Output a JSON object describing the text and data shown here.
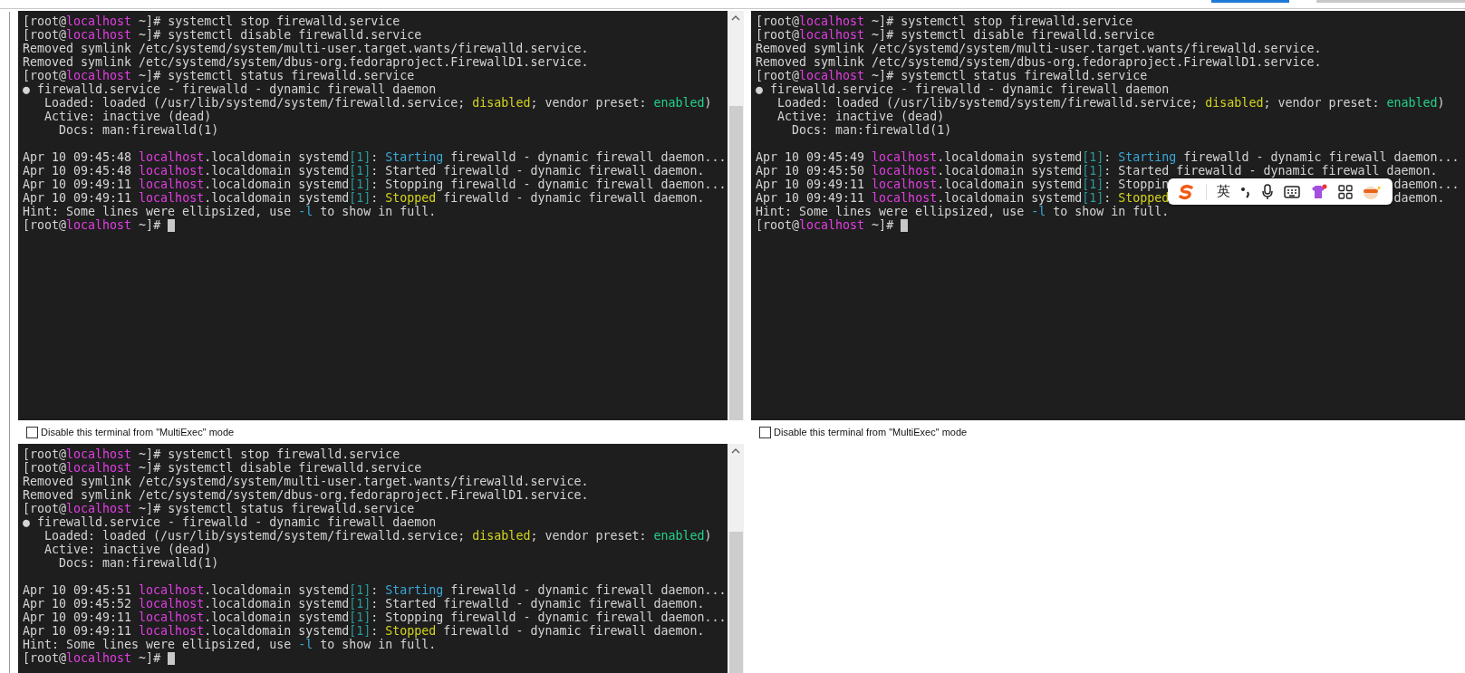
{
  "terminals": [
    {
      "scrollbar": true,
      "lines": [
        {
          "segments": [
            {
              "text": "[root@"
            },
            {
              "text": "localhost",
              "color": "#e23ee2"
            },
            {
              "text": " ~]# systemctl stop firewalld.service"
            }
          ]
        },
        {
          "segments": [
            {
              "text": "[root@"
            },
            {
              "text": "localhost",
              "color": "#e23ee2"
            },
            {
              "text": " ~]# systemctl disable firewalld.service"
            }
          ]
        },
        {
          "segments": [
            {
              "text": "Removed symlink /etc/systemd/system/multi-user.target.wants/firewalld.service."
            }
          ]
        },
        {
          "segments": [
            {
              "text": "Removed symlink /etc/systemd/system/dbus-org.fedoraproject.FirewallD1.service."
            }
          ]
        },
        {
          "segments": [
            {
              "text": "[root@"
            },
            {
              "text": "localhost",
              "color": "#e23ee2"
            },
            {
              "text": " ~]# systemctl status firewalld.service"
            }
          ]
        },
        {
          "segments": [
            {
              "text": "● firewalld.service - firewalld - dynamic firewall daemon"
            }
          ]
        },
        {
          "segments": [
            {
              "text": "   Loaded: loaded (/usr/lib/systemd/system/firewalld.service; "
            },
            {
              "text": "disabled",
              "color": "#d4d41e"
            },
            {
              "text": "; vendor preset: "
            },
            {
              "text": "enabled",
              "color": "#23d18b"
            },
            {
              "text": ")"
            }
          ]
        },
        {
          "segments": [
            {
              "text": "   Active: inactive (dead)"
            }
          ]
        },
        {
          "segments": [
            {
              "text": "     Docs: man:firewalld(1)"
            }
          ]
        },
        {
          "kind": "blank"
        },
        {
          "segments": [
            {
              "text": "Apr 10 09:45:48 "
            },
            {
              "text": "localhost",
              "color": "#e23ee2"
            },
            {
              "text": ".localdomain systemd"
            },
            {
              "text": "[1]",
              "color": "#2a9a9a"
            },
            {
              "text": ": "
            },
            {
              "text": "Starting",
              "color": "#3aa8d8"
            },
            {
              "text": " firewalld - dynamic firewall daemon..."
            }
          ]
        },
        {
          "segments": [
            {
              "text": "Apr 10 09:45:48 "
            },
            {
              "text": "localhost",
              "color": "#e23ee2"
            },
            {
              "text": ".localdomain systemd"
            },
            {
              "text": "[1]",
              "color": "#2a9a9a"
            },
            {
              "text": ": Started firewalld - dynamic firewall daemon."
            }
          ]
        },
        {
          "segments": [
            {
              "text": "Apr 10 09:49:11 "
            },
            {
              "text": "localhost",
              "color": "#e23ee2"
            },
            {
              "text": ".localdomain systemd"
            },
            {
              "text": "[1]",
              "color": "#2a9a9a"
            },
            {
              "text": ": Stopping firewalld - dynamic firewall daemon..."
            }
          ]
        },
        {
          "segments": [
            {
              "text": "Apr 10 09:49:11 "
            },
            {
              "text": "localhost",
              "color": "#e23ee2"
            },
            {
              "text": ".localdomain systemd"
            },
            {
              "text": "[1]",
              "color": "#2a9a9a"
            },
            {
              "text": ": "
            },
            {
              "text": "Stopped",
              "color": "#d4d41e"
            },
            {
              "text": " firewalld - dynamic firewall daemon."
            }
          ]
        },
        {
          "segments": [
            {
              "text": "Hint: Some lines were ellipsized, use "
            },
            {
              "text": "-l",
              "color": "#3aa8d8"
            },
            {
              "text": " to show in full."
            }
          ]
        },
        {
          "segments": [
            {
              "text": "[root@"
            },
            {
              "text": "localhost",
              "color": "#e23ee2"
            },
            {
              "text": " ~]# "
            }
          ],
          "cursor": true
        }
      ],
      "multiexec": {
        "label": "Disable this terminal from \"MultiExec\" mode",
        "checked": false
      }
    },
    {
      "lines": [
        {
          "segments": [
            {
              "text": "[root@"
            },
            {
              "text": "localhost",
              "color": "#e23ee2"
            },
            {
              "text": " ~]# systemctl stop firewalld.service"
            }
          ]
        },
        {
          "segments": [
            {
              "text": "[root@"
            },
            {
              "text": "localhost",
              "color": "#e23ee2"
            },
            {
              "text": " ~]# systemctl disable firewalld.service"
            }
          ]
        },
        {
          "segments": [
            {
              "text": "Removed symlink /etc/systemd/system/multi-user.target.wants/firewalld.service."
            }
          ]
        },
        {
          "segments": [
            {
              "text": "Removed symlink /etc/systemd/system/dbus-org.fedoraproject.FirewallD1.service."
            }
          ]
        },
        {
          "segments": [
            {
              "text": "[root@"
            },
            {
              "text": "localhost",
              "color": "#e23ee2"
            },
            {
              "text": " ~]# systemctl status firewalld.service"
            }
          ]
        },
        {
          "segments": [
            {
              "text": "● firewalld.service - firewalld - dynamic firewall daemon"
            }
          ]
        },
        {
          "segments": [
            {
              "text": "   Loaded: loaded (/usr/lib/systemd/system/firewalld.service; "
            },
            {
              "text": "disabled",
              "color": "#d4d41e"
            },
            {
              "text": "; vendor preset: "
            },
            {
              "text": "enabled",
              "color": "#23d18b"
            },
            {
              "text": ")"
            }
          ]
        },
        {
          "segments": [
            {
              "text": "   Active: inactive (dead)"
            }
          ]
        },
        {
          "segments": [
            {
              "text": "     Docs: man:firewalld(1)"
            }
          ]
        },
        {
          "kind": "blank"
        },
        {
          "segments": [
            {
              "text": "Apr 10 09:45:49 "
            },
            {
              "text": "localhost",
              "color": "#e23ee2"
            },
            {
              "text": ".localdomain systemd"
            },
            {
              "text": "[1]",
              "color": "#2a9a9a"
            },
            {
              "text": ": "
            },
            {
              "text": "Starting",
              "color": "#3aa8d8"
            },
            {
              "text": " firewalld - dynamic firewall daemon..."
            }
          ]
        },
        {
          "segments": [
            {
              "text": "Apr 10 09:45:50 "
            },
            {
              "text": "localhost",
              "color": "#e23ee2"
            },
            {
              "text": ".localdomain systemd"
            },
            {
              "text": "[1]",
              "color": "#2a9a9a"
            },
            {
              "text": ": Started firewalld - dynamic firewall daemon."
            }
          ]
        },
        {
          "segments": [
            {
              "text": "Apr 10 09:49:11 "
            },
            {
              "text": "localhost",
              "color": "#e23ee2"
            },
            {
              "text": ".localdomain systemd"
            },
            {
              "text": "[1]",
              "color": "#2a9a9a"
            },
            {
              "text": ": Stoppin"
            },
            {
              "kind": "gap"
            },
            {
              "text": "daemon..."
            }
          ]
        },
        {
          "segments": [
            {
              "text": "Apr 10 09:49:11 "
            },
            {
              "text": "localhost",
              "color": "#e23ee2"
            },
            {
              "text": ".localdomain systemd"
            },
            {
              "text": "[1]",
              "color": "#2a9a9a"
            },
            {
              "text": ": "
            },
            {
              "text": "Stopped",
              "color": "#d4d41e"
            },
            {
              "kind": "gap"
            },
            {
              "text": "daemon."
            }
          ]
        },
        {
          "segments": [
            {
              "text": "Hint: Some lines were ellipsized, use "
            },
            {
              "text": "-l",
              "color": "#3aa8d8"
            },
            {
              "text": " to show in full."
            }
          ]
        },
        {
          "segments": [
            {
              "text": "[root@"
            },
            {
              "text": "localhost",
              "color": "#e23ee2"
            },
            {
              "text": " ~]# "
            }
          ],
          "cursor": true
        }
      ],
      "multiexec": {
        "label": "Disable this terminal from \"MultiExec\" mode",
        "checked": false
      },
      "ime_toolbar": {
        "language": "英"
      }
    },
    {
      "scrollbar": true,
      "lines": [
        {
          "segments": [
            {
              "text": "[root@"
            },
            {
              "text": "localhost",
              "color": "#e23ee2"
            },
            {
              "text": " ~]# systemctl stop firewalld.service"
            }
          ]
        },
        {
          "segments": [
            {
              "text": "[root@"
            },
            {
              "text": "localhost",
              "color": "#e23ee2"
            },
            {
              "text": " ~]# systemctl disable firewalld.service"
            }
          ]
        },
        {
          "segments": [
            {
              "text": "Removed symlink /etc/systemd/system/multi-user.target.wants/firewalld.service."
            }
          ]
        },
        {
          "segments": [
            {
              "text": "Removed symlink /etc/systemd/system/dbus-org.fedoraproject.FirewallD1.service."
            }
          ]
        },
        {
          "segments": [
            {
              "text": "[root@"
            },
            {
              "text": "localhost",
              "color": "#e23ee2"
            },
            {
              "text": " ~]# systemctl status firewalld.service"
            }
          ]
        },
        {
          "segments": [
            {
              "text": "● firewalld.service - firewalld - dynamic firewall daemon"
            }
          ]
        },
        {
          "segments": [
            {
              "text": "   Loaded: loaded (/usr/lib/systemd/system/firewalld.service; "
            },
            {
              "text": "disabled",
              "color": "#d4d41e"
            },
            {
              "text": "; vendor preset: "
            },
            {
              "text": "enabled",
              "color": "#23d18b"
            },
            {
              "text": ")"
            }
          ]
        },
        {
          "segments": [
            {
              "text": "   Active: inactive (dead)"
            }
          ]
        },
        {
          "segments": [
            {
              "text": "     Docs: man:firewalld(1)"
            }
          ]
        },
        {
          "kind": "blank"
        },
        {
          "segments": [
            {
              "text": "Apr 10 09:45:51 "
            },
            {
              "text": "localhost",
              "color": "#e23ee2"
            },
            {
              "text": ".localdomain systemd"
            },
            {
              "text": "[1]",
              "color": "#2a9a9a"
            },
            {
              "text": ": "
            },
            {
              "text": "Starting",
              "color": "#3aa8d8"
            },
            {
              "text": " firewalld - dynamic firewall daemon..."
            }
          ]
        },
        {
          "segments": [
            {
              "text": "Apr 10 09:45:52 "
            },
            {
              "text": "localhost",
              "color": "#e23ee2"
            },
            {
              "text": ".localdomain systemd"
            },
            {
              "text": "[1]",
              "color": "#2a9a9a"
            },
            {
              "text": ": Started firewalld - dynamic firewall daemon."
            }
          ]
        },
        {
          "segments": [
            {
              "text": "Apr 10 09:49:11 "
            },
            {
              "text": "localhost",
              "color": "#e23ee2"
            },
            {
              "text": ".localdomain systemd"
            },
            {
              "text": "[1]",
              "color": "#2a9a9a"
            },
            {
              "text": ": Stopping firewalld - dynamic firewall daemon..."
            }
          ]
        },
        {
          "segments": [
            {
              "text": "Apr 10 09:49:11 "
            },
            {
              "text": "localhost",
              "color": "#e23ee2"
            },
            {
              "text": ".localdomain systemd"
            },
            {
              "text": "[1]",
              "color": "#2a9a9a"
            },
            {
              "text": ": "
            },
            {
              "text": "Stopped",
              "color": "#d4d41e"
            },
            {
              "text": " firewalld - dynamic firewall daemon."
            }
          ]
        },
        {
          "segments": [
            {
              "text": "Hint: Some lines were ellipsized, use "
            },
            {
              "text": "-l",
              "color": "#3aa8d8"
            },
            {
              "text": " to show in full."
            }
          ]
        },
        {
          "segments": [
            {
              "text": "[root@"
            },
            {
              "text": "localhost",
              "color": "#e23ee2"
            },
            {
              "text": " ~]# "
            }
          ],
          "cursor": true
        }
      ]
    }
  ]
}
